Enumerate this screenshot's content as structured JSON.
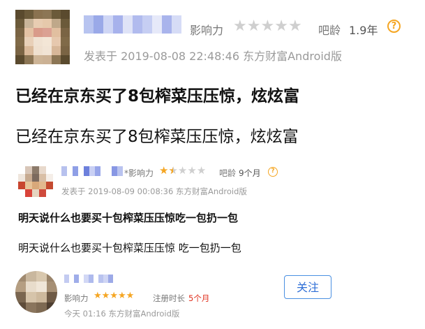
{
  "post": {
    "influence_label": "影响力",
    "influence_stars": 0,
    "age_label": "吧龄",
    "age_value": "1.9年",
    "help_icon": "question-icon",
    "meta": "发表于 2019-08-08 22:48:46 东方财富Android版",
    "title": "已经在京东买了8包榨菜压压惊，炫炫富",
    "body": "已经在京东买了8包榨菜压压惊，炫炫富"
  },
  "comment": {
    "influence_label": "*影响力",
    "influence_stars": 1.5,
    "age_label": "吧龄",
    "age_value": "9个月",
    "help_icon": "question-icon",
    "meta": "发表于 2019-08-09 00:08:36 东方财富Android版",
    "title": "明天说什么也要买十包榨菜压压惊吃一包扔一包",
    "body": "明天说什么也要买十包榨菜压压惊 吃一包扔一包"
  },
  "user_card": {
    "influence_label": "影响力",
    "influence_stars": 5,
    "register_label": "注册时长",
    "register_value": "5个月",
    "meta": "今天 01:16 东方财富Android版",
    "follow_label": "关注"
  },
  "colors": {
    "star_on": "#f5a623",
    "star_off": "#cfcfcf",
    "link_blue": "#2f6fd6",
    "red": "#e0301e"
  }
}
